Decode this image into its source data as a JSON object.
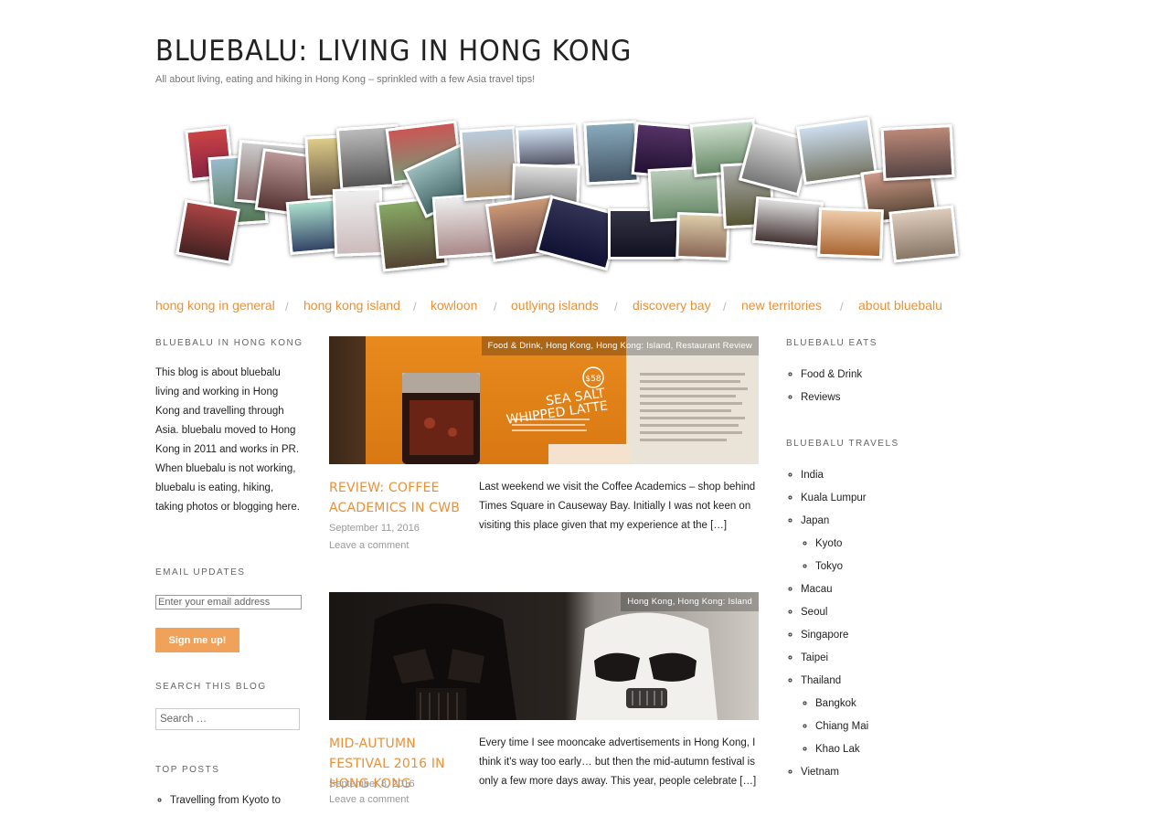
{
  "site": {
    "title": "BLUEBALU: LIVING IN HONG KONG",
    "description": "All about living, eating and hiking in Hong Kong – sprinkled with a few Asia travel tips!"
  },
  "nav": {
    "items": [
      "hong kong in general",
      "hong kong island",
      "kowloon",
      "outlying islands",
      "discovery bay",
      "new territories",
      "about bluebalu"
    ],
    "separator": "/"
  },
  "left_sidebar": {
    "about": {
      "title": "BLUEBALU IN HONG KONG",
      "text": "This blog is about bluebalu living and working in Hong Kong and travelling through Asia. bluebalu moved to Hong Kong in 2011 and works in PR. When bluebalu is not working, bluebalu is eating, hiking, taking photos or blogging here."
    },
    "email": {
      "title": "EMAIL UPDATES",
      "placeholder": "Enter your email address",
      "button": "Sign me up!"
    },
    "search": {
      "title": "SEARCH THIS BLOG",
      "placeholder": "Search …"
    },
    "top_posts": {
      "title": "TOP POSTS",
      "items": [
        "Travelling from Kyoto to"
      ]
    }
  },
  "posts": [
    {
      "categories": "Food & Drink, Hong Kong, Hong Kong: Island, Restaurant Review",
      "title": "REVIEW: COFFEE ACADEMICS IN CWB",
      "date": "September 11, 2016",
      "comments": "Leave a comment",
      "excerpt": "Last weekend we visit the Coffee Academics – shop behind Times Square in Causeway Bay. Initially I was not keen on visiting this place given that my experience at the […]",
      "thumb_text": {
        "price": "$58",
        "line1": "SEA SALT",
        "line2": "WHIPPED LATTE"
      }
    },
    {
      "categories": "Hong Kong, Hong Kong: Island",
      "title": "MID-AUTUMN FESTIVAL 2016 IN HONG KONG",
      "date": "September 8, 2016",
      "comments": "Leave a comment",
      "excerpt": "Every time I see mooncake advertisements in Hong Kong, I think it's way too early… but then the mid-autumn festival is only a few more days away. This year, people celebrate […]"
    }
  ],
  "right_sidebar": {
    "eats": {
      "title": "BLUEBALU EATS",
      "items": [
        "Food & Drink",
        "Reviews"
      ]
    },
    "travels": {
      "title": "BLUEBALU TRAVELS",
      "items": [
        {
          "label": "India"
        },
        {
          "label": "Kuala Lumpur"
        },
        {
          "label": "Japan",
          "children": [
            "Kyoto",
            "Tokyo"
          ]
        },
        {
          "label": "Macau"
        },
        {
          "label": "Seoul"
        },
        {
          "label": "Singapore"
        },
        {
          "label": "Taipei"
        },
        {
          "label": "Thailand",
          "children": [
            "Bangkok",
            "Chiang Mai",
            "Khao Lak"
          ]
        },
        {
          "label": "Vietnam"
        }
      ]
    }
  },
  "colors": {
    "accent": "#e8913a",
    "button": "#f0a25a",
    "text": "#222222",
    "muted": "#999999"
  }
}
